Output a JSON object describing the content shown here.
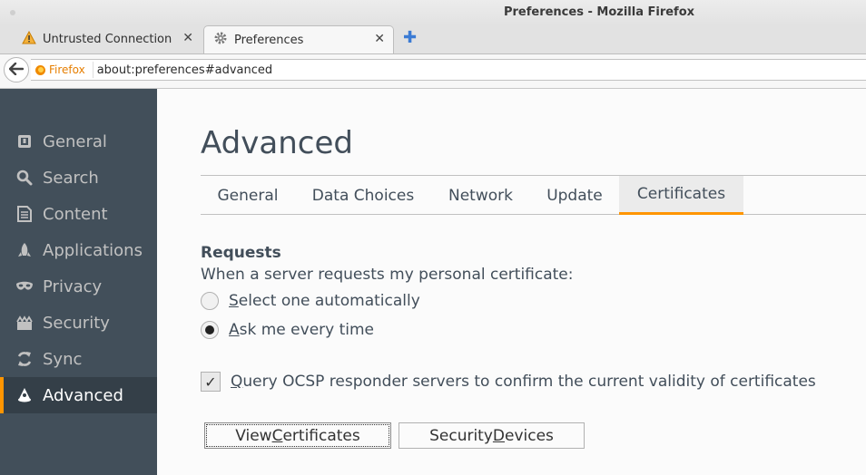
{
  "window": {
    "title": "Preferences - Mozilla Firefox"
  },
  "tabs": [
    {
      "label": "Untrusted Connection",
      "icon": "warning-icon",
      "close": "✕"
    },
    {
      "label": "Preferences",
      "icon": "gear-icon",
      "close": "✕"
    }
  ],
  "new_tab_glyph": "✚",
  "navbar": {
    "identity_label": "Firefox",
    "url": "about:preferences#advanced"
  },
  "sidebar": {
    "items": [
      {
        "label": "General",
        "icon": "general-icon"
      },
      {
        "label": "Search",
        "icon": "search-icon"
      },
      {
        "label": "Content",
        "icon": "content-icon"
      },
      {
        "label": "Applications",
        "icon": "applications-icon"
      },
      {
        "label": "Privacy",
        "icon": "privacy-mask-icon"
      },
      {
        "label": "Security",
        "icon": "security-icon"
      },
      {
        "label": "Sync",
        "icon": "sync-icon"
      },
      {
        "label": "Advanced",
        "icon": "advanced-icon"
      }
    ],
    "selected": "Advanced"
  },
  "main": {
    "title": "Advanced",
    "subtabs": [
      "General",
      "Data Choices",
      "Network",
      "Update",
      "Certificates"
    ],
    "selected_subtab": "Certificates",
    "requests": {
      "heading": "Requests",
      "description": "When a server requests my personal certificate:",
      "options": [
        {
          "accesskey": "S",
          "rest": "elect one automatically",
          "checked": false
        },
        {
          "accesskey": "A",
          "rest": "sk me every time",
          "checked": true
        }
      ]
    },
    "ocsp": {
      "accesskey": "Q",
      "rest": "uery OCSP responder servers to confirm the current validity of certificates",
      "checked": true,
      "check_glyph": "✓"
    },
    "buttons": [
      {
        "pre": "View ",
        "accesskey": "C",
        "post": "ertificates"
      },
      {
        "pre": "Security ",
        "accesskey": "D",
        "post": "evices"
      }
    ]
  },
  "colors": {
    "sidebar_bg": "#424f5a",
    "accent": "#ff9500",
    "text": "#424e5a"
  }
}
